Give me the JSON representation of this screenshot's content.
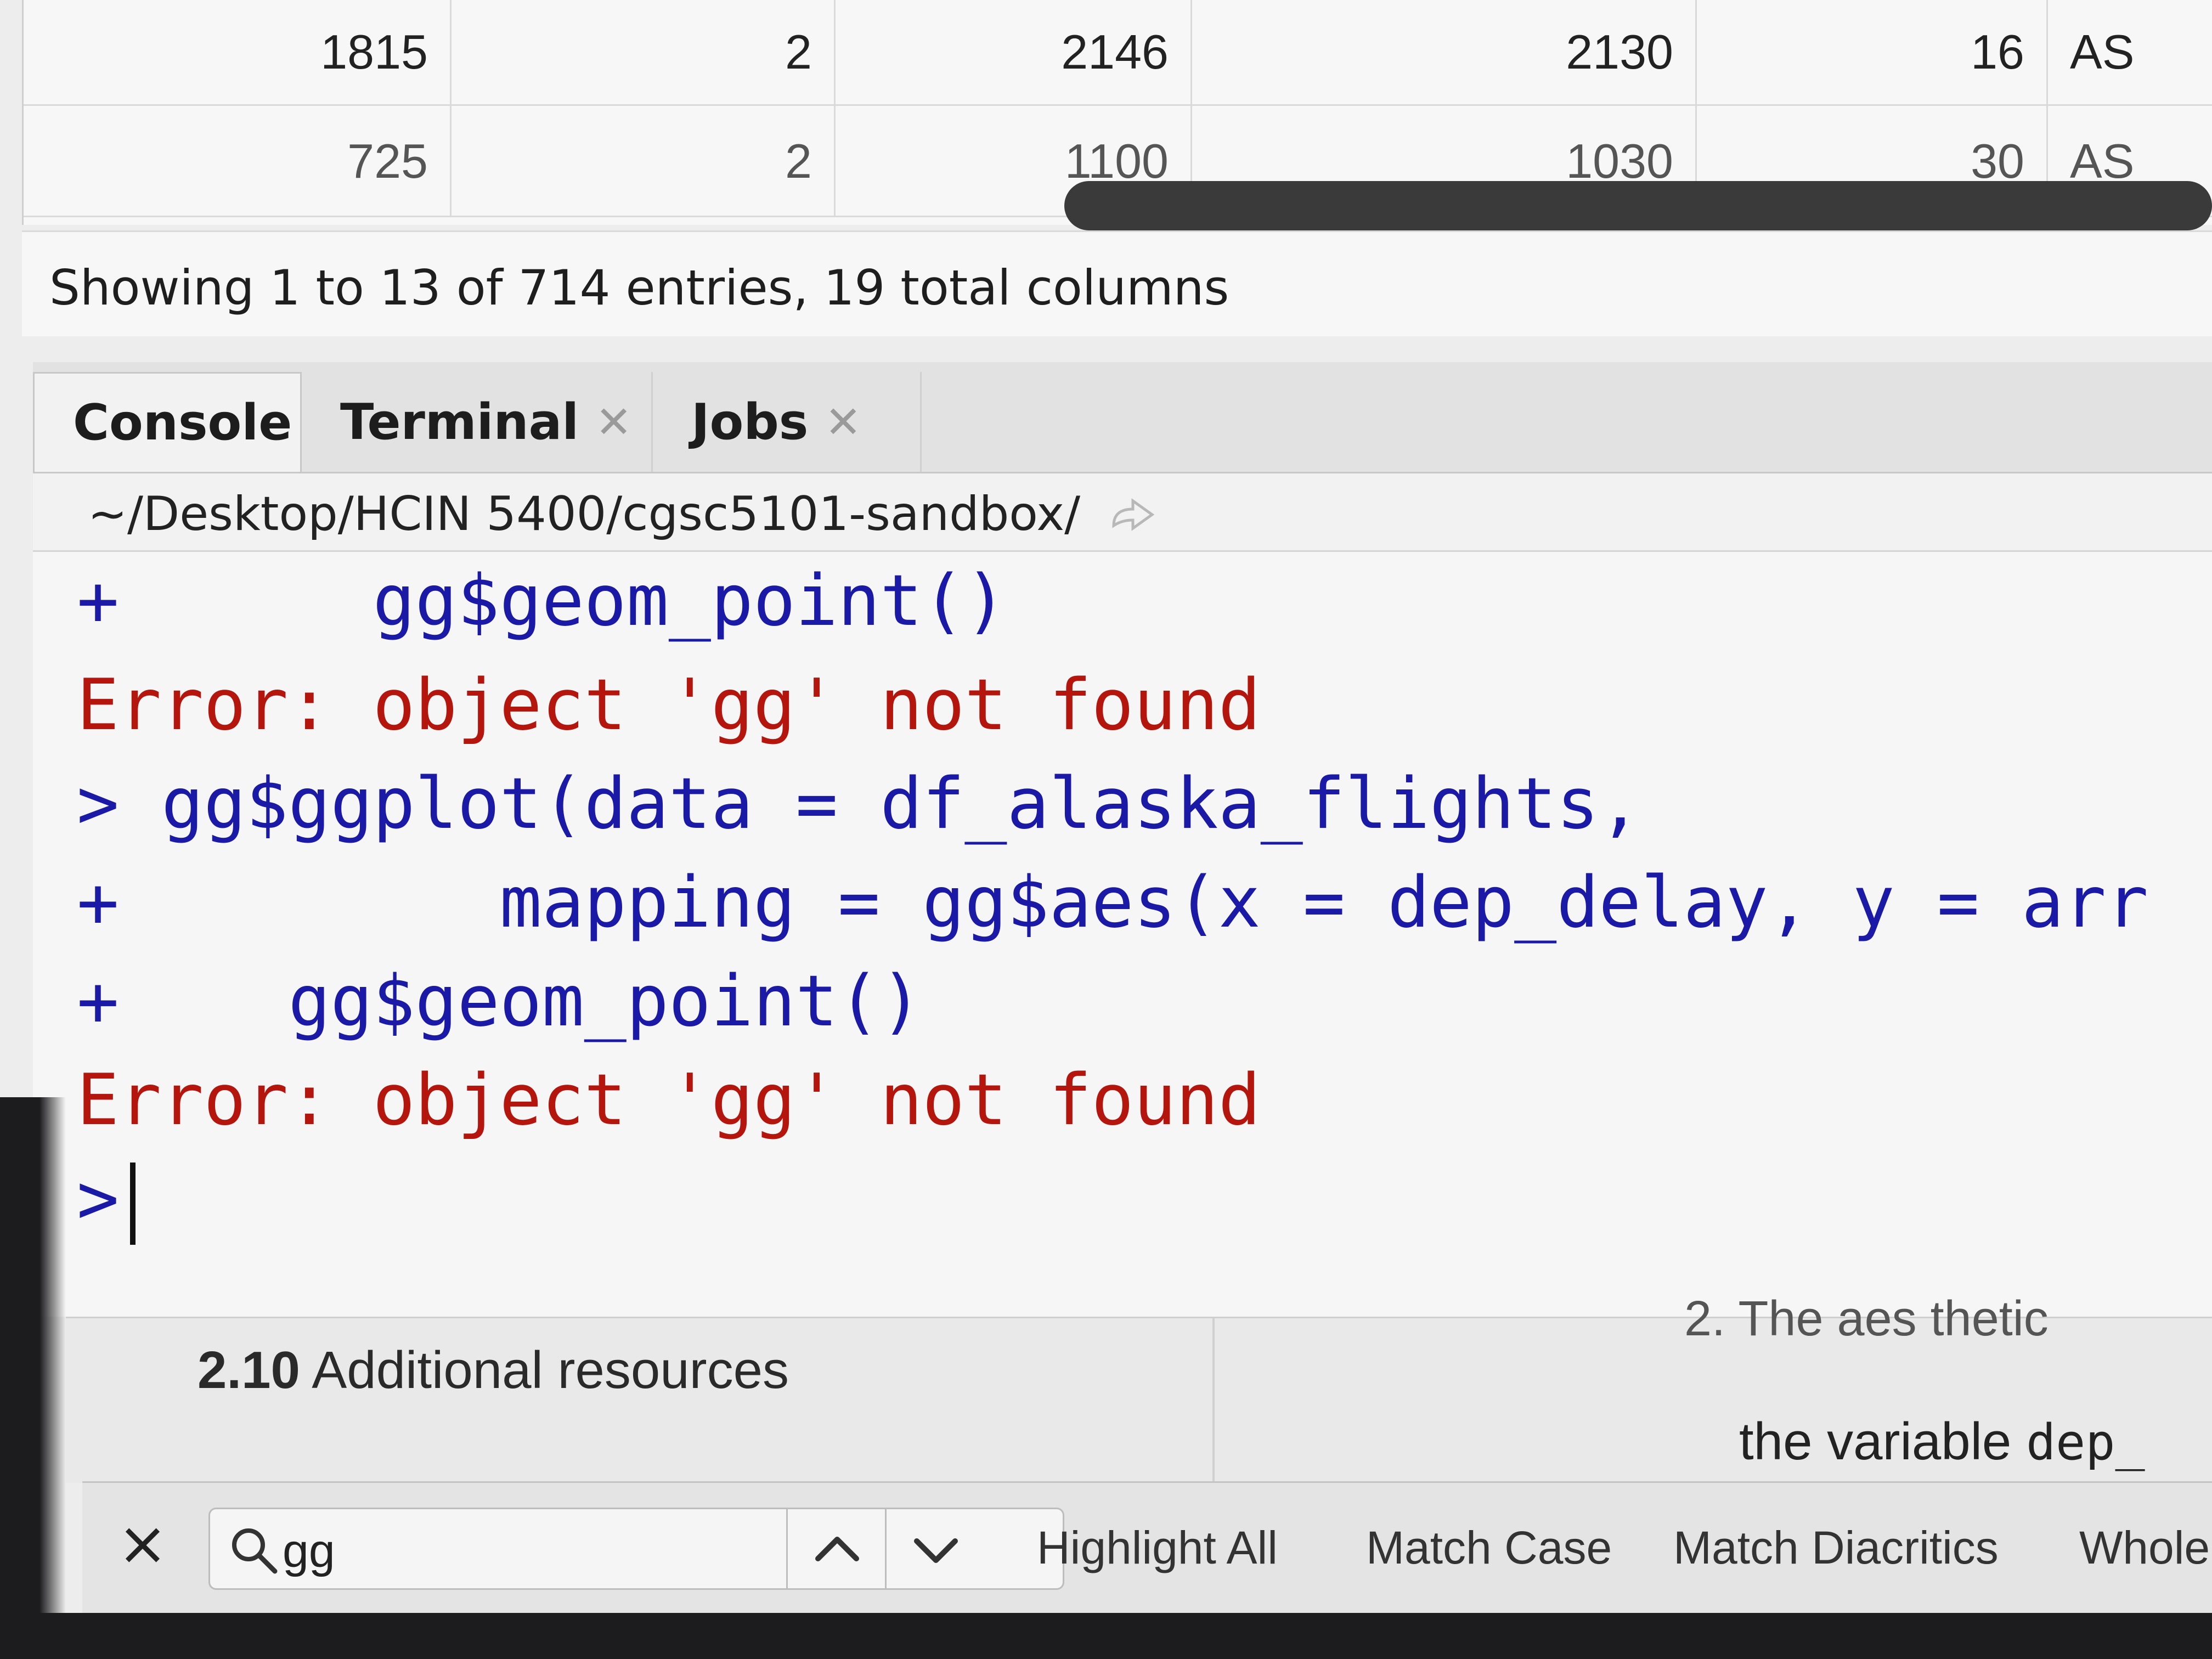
{
  "table": {
    "rows": [
      [
        "1815",
        "2",
        "2146",
        "2130",
        "16",
        "AS"
      ],
      [
        "725",
        "2",
        "1100",
        "1030",
        "30",
        "AS"
      ]
    ],
    "info": "Showing 1 to 13 of 714 entries, 19 total columns"
  },
  "console": {
    "tabs": [
      {
        "label": "Console",
        "closable": false
      },
      {
        "label": "Terminal",
        "closable": true
      },
      {
        "label": "Jobs",
        "closable": true
      }
    ],
    "path": "~/Desktop/HCIN 5400/cgsc5101-sandbox/",
    "lines": [
      "+      gg$geom_point()",
      "Error: object 'gg' not found",
      "> gg$ggplot(data = df_alaska_flights,",
      "+         mapping = gg$aes(x = dep_delay, y = arr",
      "+    gg$geom_point()",
      "Error: object 'gg' not found",
      ">"
    ],
    "colors": {
      "input": "#1a1aa6",
      "error": "#b4160e"
    }
  },
  "doc": {
    "section_number": "2.10",
    "section_title": "Additional resources",
    "right_heading_fragment": "2. The aes thetic",
    "right_text": "the variable",
    "right_code": "dep_"
  },
  "findbar": {
    "close": "×",
    "query": "gg",
    "options": [
      "Highlight All",
      "Match Case",
      "Match Diacritics",
      "Whole"
    ]
  },
  "icons": [
    "close-icon",
    "search-icon",
    "chevron-up-icon",
    "chevron-down-icon",
    "goto-dir-icon"
  ]
}
